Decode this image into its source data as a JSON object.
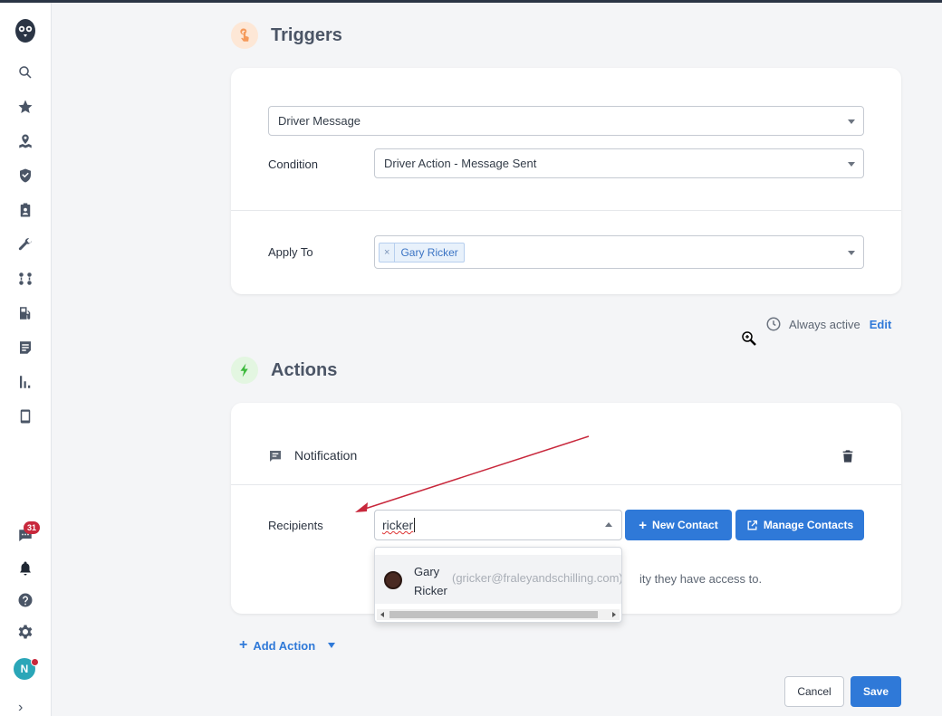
{
  "triggers": {
    "title": "Triggers",
    "trigger_type": "Driver Message",
    "condition_label": "Condition",
    "condition_value": "Driver Action - Message Sent",
    "apply_to_label": "Apply To",
    "apply_to_tag": "Gary Ricker",
    "tag_remove": "×"
  },
  "schedule": {
    "text": "Always active",
    "edit_label": "Edit"
  },
  "actions": {
    "title": "Actions",
    "notification_label": "Notification",
    "recipients_label": "Recipients",
    "recipients_input": "ricker",
    "new_contact_label": "New Contact",
    "manage_contacts_label": "Manage Contacts",
    "hint_text": "ity they have access to.",
    "add_action_label": "Add Action"
  },
  "dropdown": {
    "name": "Gary Ricker",
    "email": "(gricker@fraleyandschilling.com)"
  },
  "footer": {
    "cancel_label": "Cancel",
    "save_label": "Save"
  },
  "sidebar": {
    "notification_count": "31",
    "avatar_initial": "N",
    "expand_glyph": "›"
  },
  "colors": {
    "primary": "#2f79d8",
    "badge": "#c8283c",
    "trigger_accent": "#f59a5b",
    "action_accent": "#3cb93c"
  }
}
